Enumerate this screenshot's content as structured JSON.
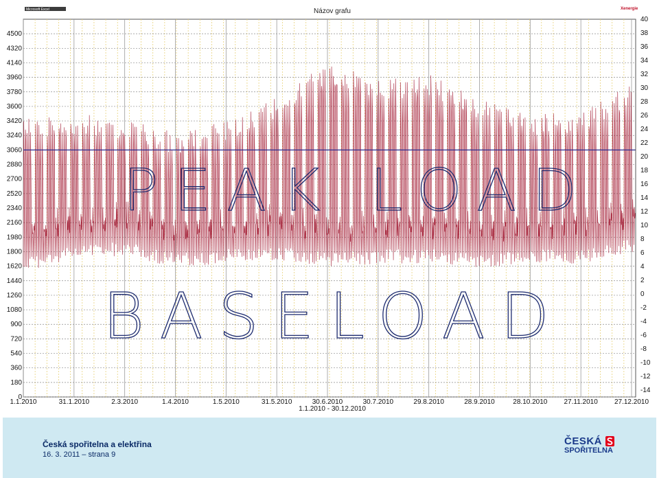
{
  "chart_data": {
    "type": "line",
    "title": "Názov grafu",
    "xlabel": "1.1.2010 - 30.12.2010",
    "y_left": {
      "ticks": [
        "0",
        "180",
        "360",
        "540",
        "720",
        "900",
        "1080",
        "1260",
        "1440",
        "1620",
        "1800",
        "1980",
        "2160",
        "2340",
        "2520",
        "2700",
        "2880",
        "3060",
        "3240",
        "3420",
        "3600",
        "3780",
        "3960",
        "4140",
        "4320",
        "4500"
      ],
      "range": [
        0,
        4680
      ]
    },
    "y_right": {
      "ticks": [
        "-14",
        "-12",
        "-10",
        "-8",
        "-6",
        "-4",
        "-2",
        "0",
        "2",
        "4",
        "6",
        "8",
        "10",
        "12",
        "14",
        "16",
        "18",
        "20",
        "22",
        "24",
        "26",
        "28",
        "30",
        "32",
        "34",
        "36",
        "38",
        "40"
      ],
      "range": [
        -15,
        40
      ]
    },
    "x_ticks": [
      "1.1.2010",
      "31.1.2010",
      "2.3.2010",
      "1.4.2010",
      "1.5.2010",
      "31.5.2010",
      "30.6.2010",
      "30.7.2010",
      "29.8.2010",
      "28.9.2010",
      "28.10.2010",
      "27.11.2010",
      "27.12.2010"
    ],
    "reference_line": {
      "value": 3060,
      "color": "#2b2b8f"
    },
    "series": [
      {
        "color": "#a0152e",
        "description_values": "hourly load, weekday peaks and base troughs",
        "weekly_peak_profile": [
          {
            "x": "1.1.2010",
            "y": 3500
          },
          {
            "x": "31.1.2010",
            "y": 3500
          },
          {
            "x": "2.3.2010",
            "y": 3480
          },
          {
            "x": "1.4.2010",
            "y": 3280
          },
          {
            "x": "1.5.2010",
            "y": 3420
          },
          {
            "x": "31.5.2010",
            "y": 3750
          },
          {
            "x": "30.6.2010",
            "y": 4150
          },
          {
            "x": "30.7.2010",
            "y": 3950
          },
          {
            "x": "29.8.2010",
            "y": 4000
          },
          {
            "x": "28.9.2010",
            "y": 3700
          },
          {
            "x": "28.10.2010",
            "y": 3500
          },
          {
            "x": "27.11.2010",
            "y": 3550
          },
          {
            "x": "27.12.2010",
            "y": 3900
          }
        ],
        "weekly_base_profile": [
          {
            "x": "1.1.2010",
            "y": 1850
          },
          {
            "x": "31.1.2010",
            "y": 2000
          },
          {
            "x": "2.3.2010",
            "y": 2050
          },
          {
            "x": "1.4.2010",
            "y": 1900
          },
          {
            "x": "1.5.2010",
            "y": 1950
          },
          {
            "x": "31.5.2010",
            "y": 2000
          },
          {
            "x": "30.6.2010",
            "y": 1900
          },
          {
            "x": "30.7.2010",
            "y": 1950
          },
          {
            "x": "29.8.2010",
            "y": 1950
          },
          {
            "x": "28.9.2010",
            "y": 1900
          },
          {
            "x": "28.10.2010",
            "y": 1950
          },
          {
            "x": "27.11.2010",
            "y": 1950
          },
          {
            "x": "27.12.2010",
            "y": 2100
          }
        ]
      }
    ],
    "annotations": [
      "PEAK LOAD",
      "BASELOAD"
    ],
    "colors": {
      "series": "#a0152e",
      "reference": "#2b2b8f",
      "grid_minor": "#e8d27a",
      "grid_major": "#9a9a9a"
    }
  },
  "header": {
    "brand_small": "Microsoft Excel",
    "logo_right": "Xenergie"
  },
  "footer": {
    "title": "Česká spořitelna a elektřina",
    "date_page": "16. 3. 2011 – strana 9",
    "logo_line1": "ČESKÁ",
    "logo_line2": "SPOŘITELNA",
    "logo_color": "#1a3a8a",
    "logo_accent": "#e2001a"
  }
}
